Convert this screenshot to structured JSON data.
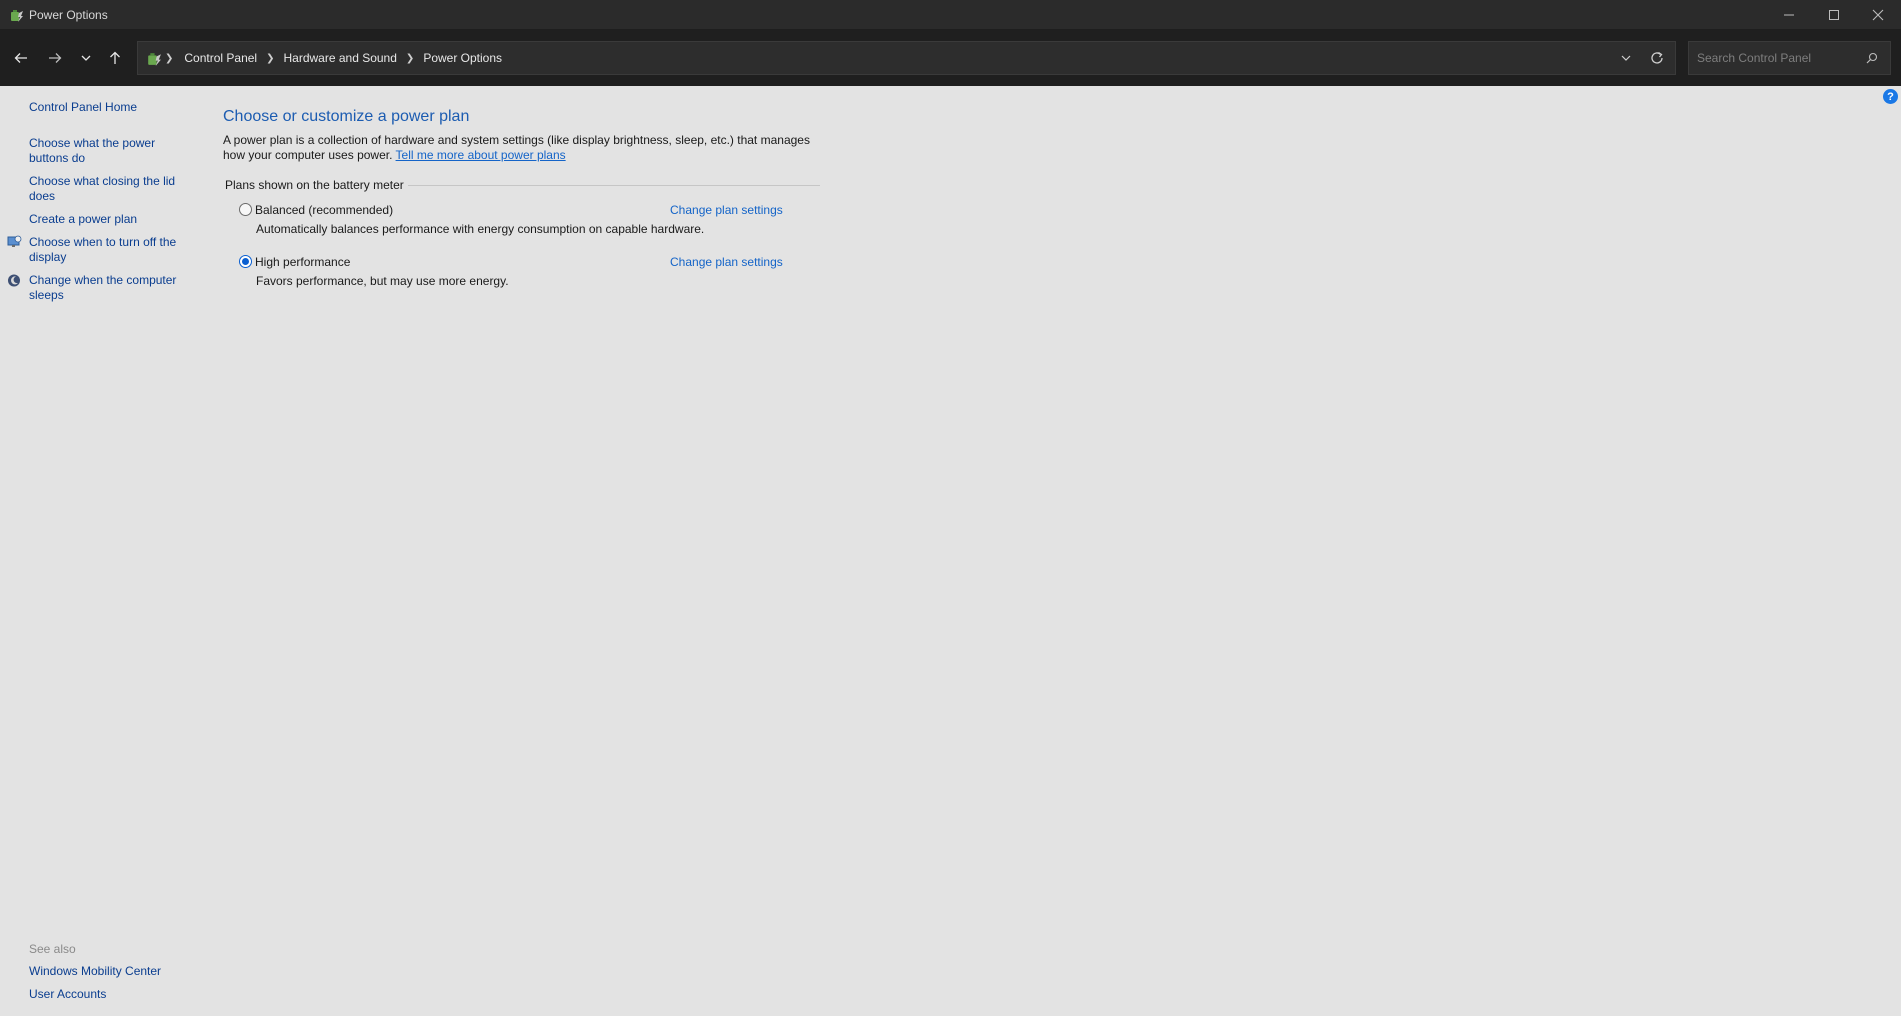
{
  "window": {
    "title": "Power Options",
    "controls": {
      "minimize": "minimize-icon",
      "maximize": "maximize-icon",
      "close": "close-icon"
    }
  },
  "nav": {
    "breadcrumb": [
      "Control Panel",
      "Hardware and Sound",
      "Power Options"
    ],
    "search_placeholder": "Search Control Panel"
  },
  "sidebar": {
    "home": "Control Panel Home",
    "links": [
      "Choose what the power buttons do",
      "Choose what closing the lid does",
      "Create a power plan",
      "Choose when to turn off the display",
      "Change when the computer sleeps"
    ],
    "see_also_label": "See also",
    "see_also": [
      "Windows Mobility Center",
      "User Accounts"
    ]
  },
  "main": {
    "heading": "Choose or customize a power plan",
    "description": "A power plan is a collection of hardware and system settings (like display brightness, sleep, etc.) that manages how your computer uses power.",
    "learn_more": "Tell me more about power plans",
    "group_label": "Plans shown on the battery meter",
    "plans": [
      {
        "name": "Balanced (recommended)",
        "description": "Automatically balances performance with energy consumption on capable hardware.",
        "link": "Change plan settings",
        "selected": false
      },
      {
        "name": "High performance",
        "description": "Favors performance, but may use more energy.",
        "link": "Change plan settings",
        "selected": true
      }
    ]
  },
  "help_label": "?",
  "colors": {
    "link": "#1464c8",
    "heading": "#1c5cb1",
    "background": "#e3e3e3",
    "titlebar": "#2b2b2b",
    "navbar": "#1f1f1f"
  }
}
